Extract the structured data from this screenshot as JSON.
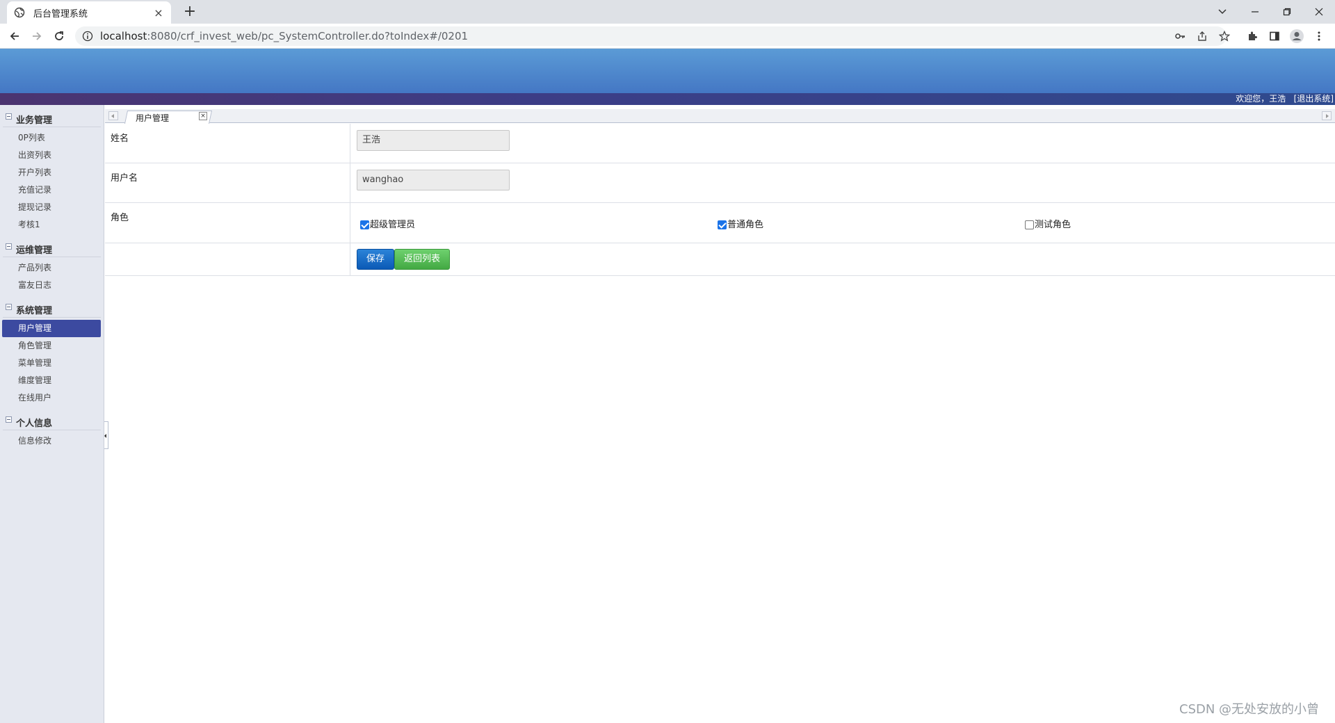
{
  "browser": {
    "tab_title": "后台管理系统",
    "tab_close": "×",
    "new_tab": "+",
    "url_host": "localhost",
    "url_rest": ":8080/crf_invest_web/pc_SystemController.do?toIndex#/0201"
  },
  "header": {
    "welcome": "欢迎您，王浩   [退出系统]"
  },
  "sidebar": {
    "groups": [
      {
        "label": "业务管理",
        "items": [
          "0P列表",
          "出资列表",
          "开户列表",
          "充值记录",
          "提现记录",
          "考核1"
        ]
      },
      {
        "label": "运维管理",
        "items": [
          "产品列表",
          "富友日志"
        ]
      },
      {
        "label": "系统管理",
        "items": [
          "用户管理",
          "角色管理",
          "菜单管理",
          "维度管理",
          "在线用户"
        ]
      },
      {
        "label": "个人信息",
        "items": [
          "信息修改"
        ]
      }
    ],
    "active_item": "用户管理"
  },
  "content_tab": {
    "label": "用户管理",
    "close": "×"
  },
  "form": {
    "name_label": "姓名",
    "name_value": "王浩",
    "username_label": "用户名",
    "username_value": "wanghao",
    "role_label": "角色",
    "roles": [
      {
        "label": "超级管理员",
        "checked": true
      },
      {
        "label": "普通角色",
        "checked": true
      },
      {
        "label": "测试角色",
        "checked": false
      }
    ],
    "save_label": "保存",
    "back_label": "返回列表"
  },
  "watermark": "CSDN @无处安放的小曾"
}
